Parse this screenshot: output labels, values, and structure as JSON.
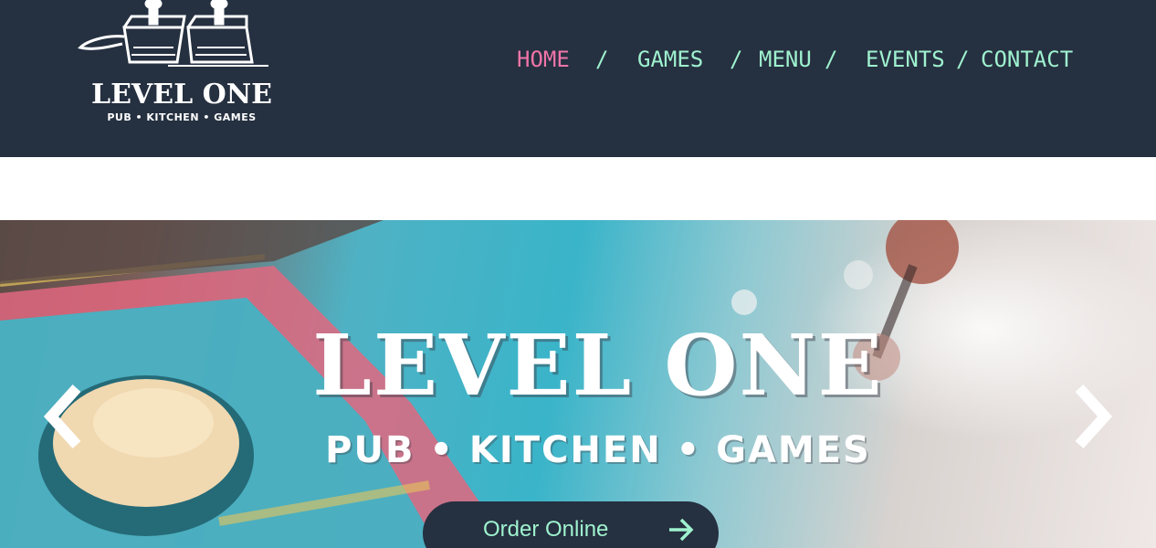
{
  "header": {
    "logo": {
      "title": "LEVEL ONE",
      "subtitle": "PUB • KITCHEN • GAMES",
      "icon": "joystick-icon"
    },
    "nav": {
      "items": [
        {
          "label": "HOME",
          "active": true
        },
        {
          "label": "GAMES",
          "active": false
        },
        {
          "label": "MENU",
          "active": false
        },
        {
          "label": "EVENTS",
          "active": false
        },
        {
          "label": "CONTACT",
          "active": false
        }
      ],
      "separator": "/"
    }
  },
  "hero": {
    "title": "LEVEL ONE",
    "subtitle": "PUB • KITCHEN • GAMES",
    "order_button": {
      "label": "Order Online",
      "icon": "arrow-right-icon"
    },
    "prev_icon": "chevron-left-icon",
    "next_icon": "chevron-right-icon"
  },
  "colors": {
    "header_bg": "#253040",
    "nav_text": "#9ff2cf",
    "nav_active": "#f075a9",
    "button_bg": "#253040",
    "button_text": "#9ff2cf"
  }
}
